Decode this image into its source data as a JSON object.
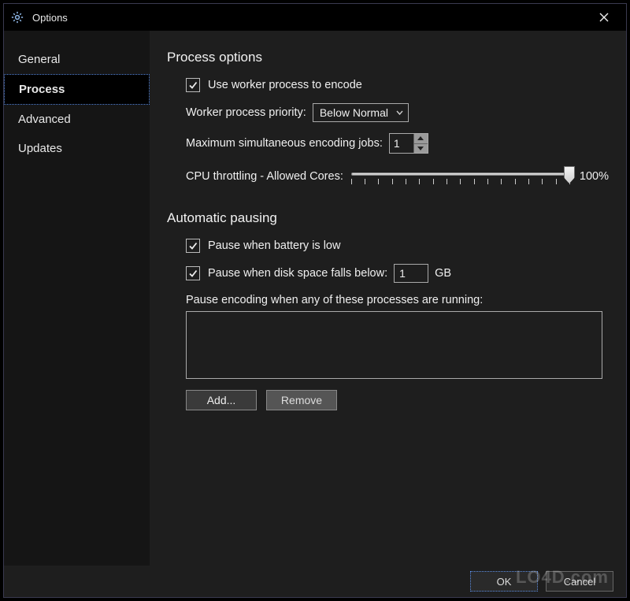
{
  "window": {
    "title": "Options"
  },
  "sidebar": {
    "items": [
      {
        "label": "General",
        "active": false
      },
      {
        "label": "Process",
        "active": true
      },
      {
        "label": "Advanced",
        "active": false
      },
      {
        "label": "Updates",
        "active": false
      }
    ]
  },
  "process": {
    "heading": "Process options",
    "useWorkerLabel": "Use worker process to encode",
    "useWorkerChecked": true,
    "priorityLabel": "Worker process priority:",
    "priorityValue": "Below Normal",
    "maxJobsLabel": "Maximum simultaneous encoding jobs:",
    "maxJobsValue": "1",
    "cpuLabel": "CPU throttling - Allowed Cores:",
    "cpuPercent": "100%"
  },
  "pausing": {
    "heading": "Automatic pausing",
    "batteryLabel": "Pause when battery is low",
    "batteryChecked": true,
    "diskLabel": "Pause when disk space falls below:",
    "diskChecked": true,
    "diskValue": "1",
    "diskUnit": "GB",
    "procLabel": "Pause encoding when any of these processes are running:",
    "addLabel": "Add...",
    "removeLabel": "Remove"
  },
  "footer": {
    "ok": "OK",
    "cancel": "Cancel"
  },
  "watermark": "LO4D.com"
}
